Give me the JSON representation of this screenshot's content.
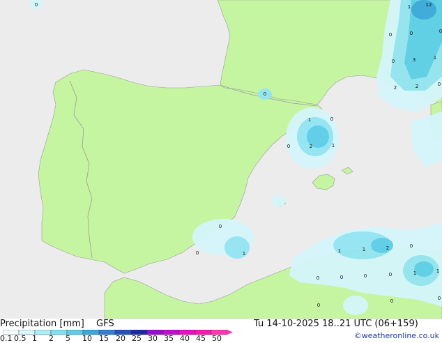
{
  "legend": {
    "product_label": "Precipitation [mm]",
    "model_label": "GFS",
    "valid_time": "Tu 14-10-2025 18..21 UTC (06+159)",
    "credit": "©weatheronline.co.uk",
    "scale_values": [
      "0.1",
      "0.5",
      "1",
      "2",
      "5",
      "10",
      "15",
      "20",
      "25",
      "30",
      "35",
      "40",
      "45",
      "50"
    ],
    "scale_colors": [
      "#f5fdfd",
      "#d6f7fb",
      "#a9eef6",
      "#7fe0f0",
      "#5ccce8",
      "#3aa8de",
      "#2f7fd6",
      "#2450c4",
      "#1c2aa8",
      "#9b0ad6",
      "#c40bd2",
      "#e112c8",
      "#f21cb0",
      "#fa3ab0"
    ]
  },
  "colors": {
    "sea": "#ececec",
    "land": "#c6f5a2",
    "border": "#9a9a9a",
    "precip_light": "#d4f6fb",
    "precip_mid": "#93e4f3",
    "precip_heavy": "#5ccde8",
    "precip_max": "#3aa8de"
  },
  "precip_labels": [
    {
      "name": "label-top-left",
      "value": "0"
    },
    {
      "name": "label-france-e1",
      "value": "1"
    },
    {
      "name": "label-france-e12",
      "value": "12"
    },
    {
      "name": "label-france-e2",
      "value": "0"
    },
    {
      "name": "label-france-e3",
      "value": "0"
    },
    {
      "name": "label-france-e4",
      "value": "0"
    },
    {
      "name": "label-france-e5",
      "value": "3"
    },
    {
      "name": "label-france-e6",
      "value": "1"
    },
    {
      "name": "label-france-e7",
      "value": "2"
    },
    {
      "name": "label-france-e8",
      "value": "2"
    },
    {
      "name": "label-france-e9",
      "value": "0"
    },
    {
      "name": "label-pyrenees",
      "value": "0"
    },
    {
      "name": "label-catalonia-1",
      "value": "1"
    },
    {
      "name": "label-catalonia-2",
      "value": "0"
    },
    {
      "name": "label-catalonia-3",
      "value": "0"
    },
    {
      "name": "label-catalonia-4",
      "value": "2"
    },
    {
      "name": "label-catalonia-5",
      "value": "1"
    },
    {
      "name": "label-south-spain-1",
      "value": "0"
    },
    {
      "name": "label-south-spain-2",
      "value": "0"
    },
    {
      "name": "label-south-spain-3",
      "value": "1"
    },
    {
      "name": "label-algeria-1",
      "value": "1"
    },
    {
      "name": "label-algeria-2",
      "value": "1"
    },
    {
      "name": "label-algeria-3",
      "value": "2"
    },
    {
      "name": "label-algeria-4",
      "value": "0"
    },
    {
      "name": "label-algeria-5",
      "value": "0"
    },
    {
      "name": "label-algeria-6",
      "value": "0"
    },
    {
      "name": "label-algeria-7",
      "value": "0"
    },
    {
      "name": "label-algeria-8",
      "value": "0"
    },
    {
      "name": "label-algeria-9",
      "value": "1"
    },
    {
      "name": "label-algeria-10",
      "value": "1"
    },
    {
      "name": "label-algeria-11",
      "value": "0"
    },
    {
      "name": "label-algeria-12",
      "value": "0"
    },
    {
      "name": "label-algeria-13",
      "value": "0"
    },
    {
      "name": "label-algeria-14",
      "value": "0"
    }
  ]
}
